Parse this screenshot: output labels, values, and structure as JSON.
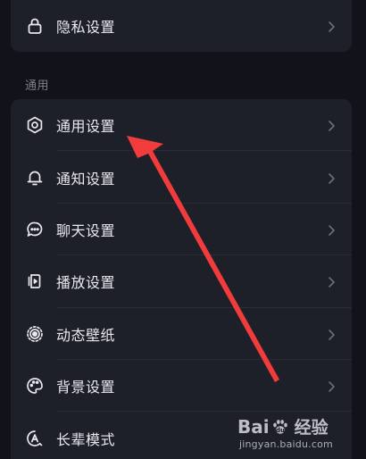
{
  "top_section": {
    "items": [
      {
        "label": "隐私设置",
        "icon": "lock-icon"
      }
    ]
  },
  "general_section": {
    "title": "通用",
    "items": [
      {
        "label": "通用设置",
        "icon": "gear-icon"
      },
      {
        "label": "通知设置",
        "icon": "bell-icon"
      },
      {
        "label": "聊天设置",
        "icon": "chat-bubble-icon"
      },
      {
        "label": "播放设置",
        "icon": "playback-device-icon"
      },
      {
        "label": "动态壁纸",
        "icon": "live-wallpaper-icon"
      },
      {
        "label": "背景设置",
        "icon": "palette-icon"
      },
      {
        "label": "长辈模式",
        "icon": "elder-mode-icon"
      }
    ]
  },
  "watermark": {
    "brand_left": "Bai",
    "brand_right": "经验",
    "url": "jingyan.baidu.com"
  },
  "colors": {
    "background": "#12131a",
    "card": "#1e2029",
    "text": "#e8e9ee",
    "secondary_text": "#7d7f89",
    "annotation_arrow": "#f23c3c"
  }
}
